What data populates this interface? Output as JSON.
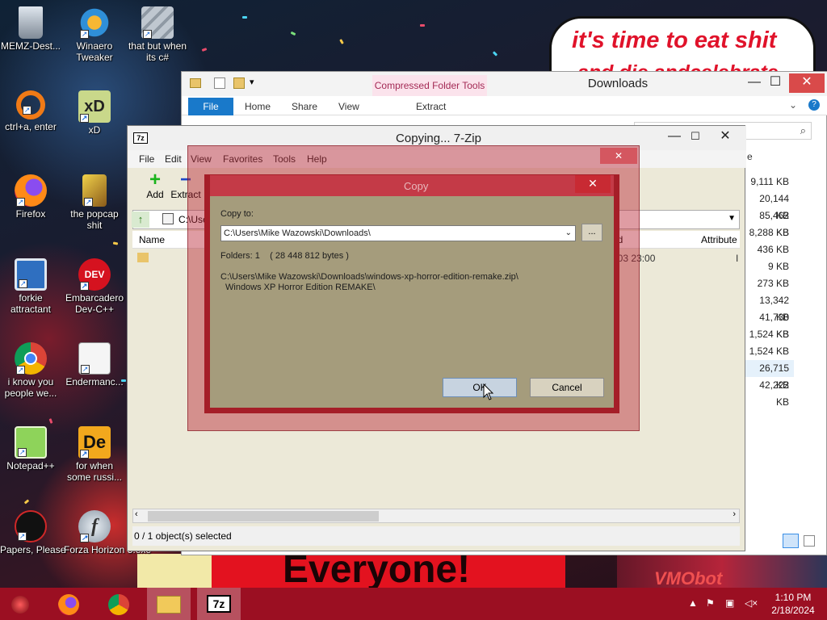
{
  "desktop": {
    "icons": [
      {
        "label": "MEMZ-Dest...",
        "icon": "recycle-bin-icon"
      },
      {
        "label": "Winaero Tweaker",
        "icon": "winaero-icon"
      },
      {
        "label": "that but when its c#",
        "icon": "windows-icon"
      },
      {
        "label": "ctrl+a, enter",
        "icon": "ring-icon"
      },
      {
        "label": "xD",
        "icon": "hxd-icon"
      },
      {
        "label": "Firefox",
        "icon": "firefox-icon"
      },
      {
        "label": "the popcap shit",
        "icon": "popcap-icon"
      },
      {
        "label": "forkie attractant",
        "icon": "monitor-gear-icon"
      },
      {
        "label": "Embarcadero Dev-C++",
        "icon": "devcpp-icon"
      },
      {
        "label": "i know you people we...",
        "icon": "chrome-icon"
      },
      {
        "label": "Endermanc...",
        "icon": "document-icon"
      },
      {
        "label": "Notepad++",
        "icon": "notepadpp-icon"
      },
      {
        "label": "for when some russi...",
        "icon": "de-icon"
      },
      {
        "label": "Papers, Please",
        "icon": "papers-please-icon"
      },
      {
        "label": "Forza Horizon 5.exe",
        "icon": "flash-icon"
      }
    ],
    "wallpaper": {
      "banner_line1": "it's time to eat shit",
      "banner_line2": "and die andcelebrate",
      "bottom_text": "Everyone!",
      "corner_text": "VMObot"
    }
  },
  "explorer": {
    "title": "Downloads",
    "context_tab": "Compressed Folder Tools",
    "tabs": [
      "File",
      "Home",
      "Share",
      "View"
    ],
    "context_subtab": "Extract",
    "size_header": "e",
    "sizes": [
      "9,111 KB",
      "20,144 KB",
      "85,462 KB",
      "8,288 KB",
      "436 KB",
      "9 KB",
      "273 KB",
      "13,342 KB",
      "41,730 KB",
      "1,524 KB",
      "1,524 KB",
      "26,715 KB",
      "42,222 KB"
    ],
    "controls": {
      "minimize": "—",
      "maximize": "☐",
      "close": "✕"
    }
  },
  "sevenzip": {
    "title": "Copying... 7-Zip",
    "logo": "7z",
    "menu": [
      "File",
      "Edit",
      "View",
      "Favorites",
      "Tools",
      "Help"
    ],
    "toolbar": [
      {
        "label": "Add",
        "icon": "plus-icon"
      },
      {
        "label": "Extract",
        "icon": "minus-icon"
      }
    ],
    "address": "C:\\Use",
    "columns": {
      "name": "Name",
      "modified": "ed",
      "attributes": "Attribute"
    },
    "row_date": "9-03 23:00",
    "row_attr": "I",
    "status": "0 / 1 object(s) selected"
  },
  "copy_dialog": {
    "title": "Copy",
    "copy_to_label": "Copy to:",
    "path": "C:\\Users\\Mike Wazowski\\Downloads\\",
    "browse": "...",
    "folders_info": "Folders: 1    ( 28 448 812 bytes )",
    "source_path": "C:\\Users\\Mike Wazowski\\Downloads\\windows-xp-horror-edition-remake.zip\\",
    "source_name": "Windows XP Horror Edition REMAKE\\",
    "ok": "OK",
    "cancel": "Cancel",
    "close": "✕"
  },
  "taskbar": {
    "apps": [
      "start-icon",
      "firefox-icon",
      "chrome-icon",
      "file-explorer-icon",
      "sevenzip-icon"
    ],
    "time": "1:10 PM",
    "date": "2/18/2024",
    "colors": {
      "taskbar": "#9b0f22",
      "accent": "#1979ca"
    }
  }
}
